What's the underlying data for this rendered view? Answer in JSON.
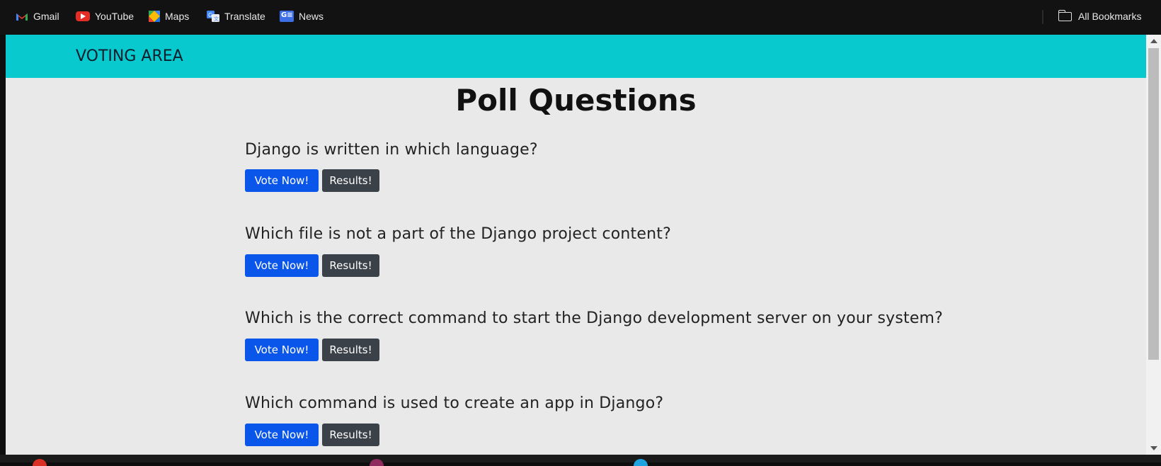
{
  "bookmarks": {
    "items": [
      {
        "label": "Gmail",
        "icon": "gmail-icon"
      },
      {
        "label": "YouTube",
        "icon": "youtube-icon"
      },
      {
        "label": "Maps",
        "icon": "maps-icon"
      },
      {
        "label": "Translate",
        "icon": "translate-icon"
      },
      {
        "label": "News",
        "icon": "news-icon"
      }
    ],
    "all_bookmarks": "All Bookmarks"
  },
  "navbar": {
    "brand": "VOTING AREA"
  },
  "main": {
    "title": "Poll Questions",
    "questions": [
      {
        "text": "Django is written in which language?",
        "vote_label": "Vote Now!",
        "results_label": "Results!"
      },
      {
        "text": "Which file is not a part of the Django project content?",
        "vote_label": "Vote Now!",
        "results_label": "Results!"
      },
      {
        "text": "Which is the correct command to start the Django development server on your system?",
        "vote_label": "Vote Now!",
        "results_label": "Results!"
      },
      {
        "text": "Which command is used to create an app in Django?",
        "vote_label": "Vote Now!",
        "results_label": "Results!"
      }
    ]
  },
  "colors": {
    "navbar": "#08c9cd",
    "vote_button": "#0a56ea",
    "results_button": "#3a4149",
    "page_background": "#e9e9e9"
  }
}
